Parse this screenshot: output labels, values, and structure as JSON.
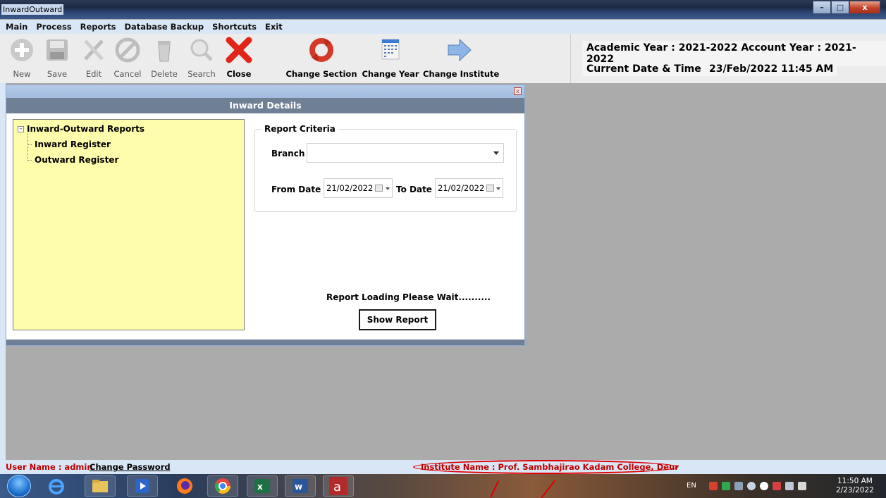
{
  "window": {
    "title": "InwardOutward",
    "minimize": "–",
    "maximize": "□",
    "close": "x"
  },
  "menu": [
    "Main",
    "Process",
    "Reports",
    "Database Backup",
    "Shortcuts",
    "Exit"
  ],
  "toolbar": {
    "new": "New",
    "save": "Save",
    "edit": "Edit",
    "cancel": "Cancel",
    "delete": "Delete",
    "search": "Search",
    "close": "Close",
    "change_section": "Change Section",
    "change_year": "Change Year",
    "change_institute": "Change Institute"
  },
  "info": {
    "years": "Academic Year : 2021-2022 Account Year : 2021-2022",
    "datetime_label": "Current Date & Time :",
    "datetime_value": "23/Feb/2022 11:45 AM"
  },
  "child": {
    "close_glyph": "x",
    "header": "Inward Details",
    "tree": {
      "root": "Inward-Outward Reports",
      "items": [
        "Inward Register",
        "Outward Register"
      ]
    },
    "criteria": {
      "title": "Report Criteria",
      "branch_label": "Branch",
      "branch_value": "",
      "from_label": "From Date",
      "from_value": "21/02/2022",
      "to_label": "To Date",
      "to_value": "21/02/2022"
    },
    "loading": "Report Loading Please Wait..........",
    "show_report": "Show Report"
  },
  "status": {
    "user": "User Name : admin",
    "change_password": "Change Password",
    "institute": "Institute Name : Prof. Sambhajirao Kadam College, Deur"
  },
  "taskbar": {
    "lang": "EN",
    "time": "11:50 AM",
    "date": "2/23/2022"
  },
  "colors": {
    "accent_red": "#c00000",
    "tree_bg": "#fdfdab",
    "header_bg": "#6f7f94"
  }
}
